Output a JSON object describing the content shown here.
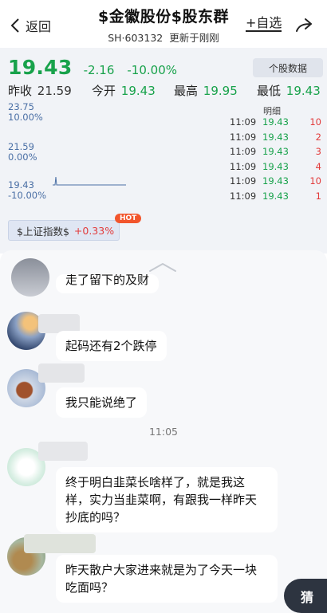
{
  "header": {
    "back_label": "返回",
    "title": "$金徽股份$股东群",
    "code": "SH·603132",
    "updated": "更新于刚刚",
    "add_label": "+自选"
  },
  "quote": {
    "price": "19.43",
    "change": "-2.16",
    "change_pct": "-10.00%",
    "stock_data_label": "个股数据",
    "prev_close_label": "昨收",
    "prev_close": "21.59",
    "open_label": "今开",
    "open": "19.43",
    "high_label": "最高",
    "high": "19.95",
    "low_label": "最低",
    "low": "19.43",
    "axis": {
      "top_price": "23.75",
      "top_pct": "10.00%",
      "mid_price": "21.59",
      "mid_pct": "0.00%",
      "bottom_price": "19.43",
      "bottom_pct": "-10.00%"
    },
    "detail_label": "明细",
    "trades": [
      {
        "time": "11:09",
        "price": "19.43",
        "qty": "10"
      },
      {
        "time": "11:09",
        "price": "19.43",
        "qty": "2"
      },
      {
        "time": "11:09",
        "price": "19.43",
        "qty": "3"
      },
      {
        "time": "11:09",
        "price": "19.43",
        "qty": "4"
      },
      {
        "time": "11:09",
        "price": "19.43",
        "qty": "10"
      },
      {
        "time": "11:09",
        "price": "19.43",
        "qty": "1"
      }
    ],
    "index_label": "$上证指数$",
    "index_change": "+0.33%",
    "hot_label": "HOT"
  },
  "chat": {
    "messages": [
      {
        "text": "走了留下的及财"
      },
      {
        "text": "起码还有2个跌停"
      },
      {
        "text": "我只能说绝了"
      },
      {
        "text": "终于明白韭菜长啥样了，就是我这样，实力当韭菜啊，有跟我一样昨天抄底的吗？"
      },
      {
        "text": "昨天散户大家进来就是为了今天一块吃面吗？"
      }
    ],
    "time_separator": "11:05",
    "guess_label": "猜"
  },
  "colors": {
    "down_green": "#18a24b",
    "up_red": "#e23b3b",
    "axis_blue": "#4a6fa5",
    "hot_orange": "#f2552c"
  }
}
